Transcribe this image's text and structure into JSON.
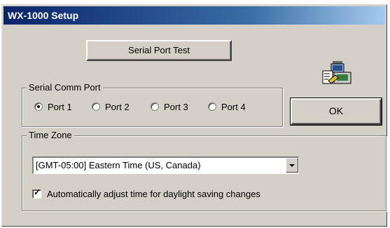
{
  "window": {
    "title": "WX-1000 Setup"
  },
  "buttons": {
    "serial_port_test": "Serial Port Test",
    "ok": "OK"
  },
  "serial_comm_port": {
    "label": "Serial Comm Port",
    "options": [
      "Port 1",
      "Port 2",
      "Port 3",
      "Port 4"
    ],
    "selected": "Port 1"
  },
  "time_zone": {
    "label": "Time Zone",
    "selected": "[GMT-05:00] Eastern Time (US, Canada)",
    "auto_dst_label": "Automatically adjust time for daylight saving changes",
    "auto_dst_checked": true
  },
  "icons": {
    "app": "setup-app-icon"
  }
}
